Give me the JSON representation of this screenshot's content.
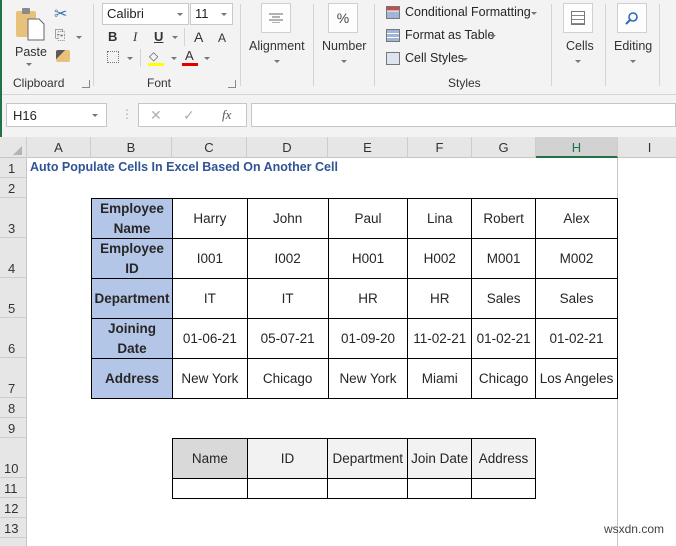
{
  "ribbon": {
    "clipboard": {
      "paste_label": "Paste",
      "group_label": "Clipboard"
    },
    "font": {
      "font_name": "Calibri",
      "font_size": "11",
      "bold": "B",
      "italic": "I",
      "underline": "U",
      "grow": "A",
      "shrink": "A",
      "group_label": "Font",
      "fill_color": "#ffff00",
      "font_color": "#e00000"
    },
    "alignment": {
      "label": "Alignment"
    },
    "number": {
      "label": "Number",
      "icon_glyph": "%"
    },
    "styles": {
      "conditional_formatting": "Conditional Formatting",
      "format_as_table": "Format as Table",
      "cell_styles": "Cell Styles",
      "group_label": "Styles"
    },
    "cells": {
      "label": "Cells"
    },
    "editing": {
      "label": "Editing"
    }
  },
  "formula_bar": {
    "name_box": "H16",
    "cancel_glyph": "✕",
    "enter_glyph": "✓",
    "fx_glyph": "fx",
    "formula": ""
  },
  "columns": [
    "A",
    "B",
    "C",
    "D",
    "E",
    "F",
    "G",
    "H",
    "I"
  ],
  "selected_column": "H",
  "rows": [
    "1",
    "2",
    "3",
    "4",
    "5",
    "6",
    "7",
    "8",
    "9",
    "10",
    "11",
    "12",
    "13"
  ],
  "sheet": {
    "title": "Auto Populate Cells In Excel Based On Another Cell",
    "employee_table": {
      "row_headers": [
        "Employee Name",
        "Employee ID",
        "Department",
        "Joining Date",
        "Address"
      ],
      "rows": [
        [
          "Harry",
          "John",
          "Paul",
          "Lina",
          "Robert",
          "Alex"
        ],
        [
          "I001",
          "I002",
          "H001",
          "H002",
          "M001",
          "M002"
        ],
        [
          "IT",
          "IT",
          "HR",
          "HR",
          "Sales",
          "Sales"
        ],
        [
          "01-06-21",
          "05-07-21",
          "01-09-20",
          "11-02-21",
          "01-02-21",
          "01-02-21"
        ],
        [
          "New York",
          "Chicago",
          "New York",
          "Miami",
          "Chicago",
          "Los Angeles"
        ]
      ]
    },
    "lookup_table": {
      "headers": [
        "Name",
        "ID",
        "Department",
        "Join Date",
        "Address"
      ],
      "values": [
        "",
        "",
        "",
        "",
        ""
      ]
    }
  },
  "watermark": "wsxdn.com"
}
